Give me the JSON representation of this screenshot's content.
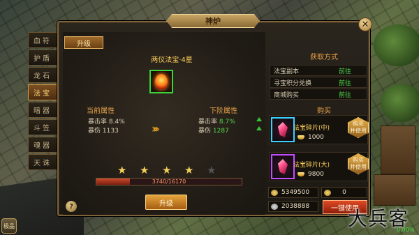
{
  "window": {
    "title": "神炉",
    "close_icon": "close-icon"
  },
  "side_tabs": [
    {
      "label": "血符",
      "active": false
    },
    {
      "label": "护盾",
      "active": false
    },
    {
      "label": "龙石",
      "active": false
    },
    {
      "label": "法宝",
      "active": true
    },
    {
      "label": "暗器",
      "active": false
    },
    {
      "label": "斗笠",
      "active": false
    },
    {
      "label": "魂器",
      "active": false
    },
    {
      "label": "天诛",
      "active": false
    }
  ],
  "sub_tab": {
    "label": "升级"
  },
  "item": {
    "name": "两仪法宝·4星"
  },
  "current": {
    "title": "当前属性",
    "crit_rate_label": "暴击率",
    "crit_rate_value": "8.4%",
    "crit_dmg_label": "暴伤",
    "crit_dmg_value": "1133"
  },
  "next": {
    "title": "下阶属性",
    "crit_rate_label": "暴击率",
    "crit_rate_value": "8.7%",
    "crit_dmg_label": "暴伤",
    "crit_dmg_value": "1287"
  },
  "stars": {
    "filled": 4,
    "total": 5
  },
  "progress": {
    "current": 3740,
    "max": 16170,
    "text": "3740/16170"
  },
  "upgrade_button": "升级",
  "help_icon": "?",
  "acquire": {
    "title": "获取方式",
    "rows": [
      {
        "name": "法宝副本",
        "action": "前往"
      },
      {
        "name": "寻宝积分兑换",
        "action": "前往"
      },
      {
        "name": "商城购买",
        "action": "前往"
      }
    ]
  },
  "buy": {
    "title": "购买",
    "items": [
      {
        "name": "法宝碎片(中)",
        "price": "1000",
        "button": "购买\n并使用",
        "rarity_color": "#3ad0ff"
      },
      {
        "name": "法宝碎片(大)",
        "price": "9800",
        "button": "购买\n并使用",
        "rarity_color": "#c34cff"
      }
    ]
  },
  "currency": {
    "gold_ingots": "5349500",
    "bound_ingots": "0",
    "coins": "2038888",
    "topup_button": "一键使用"
  },
  "watermark": "大兵客",
  "corner_value": "0.00%",
  "avatar_label": "极品"
}
